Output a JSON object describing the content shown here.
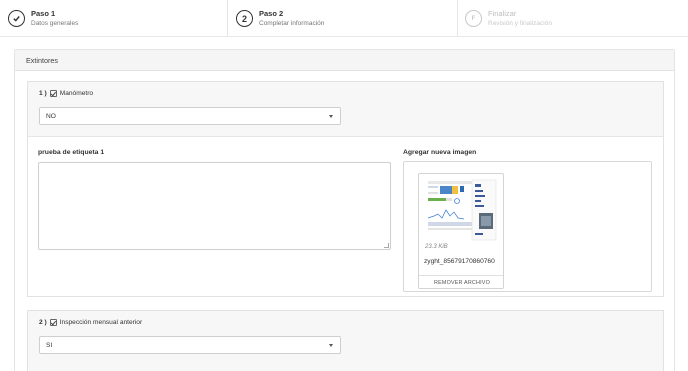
{
  "stepper": {
    "steps": [
      {
        "badge": "",
        "title": "Paso 1",
        "subtitle": "Datos generales",
        "state": "done"
      },
      {
        "badge": "2",
        "title": "Paso 2",
        "subtitle": "Completar información",
        "state": "active"
      },
      {
        "badge": "F",
        "title": "Finalizar",
        "subtitle": "Revisión y finalización",
        "state": "disabled"
      }
    ]
  },
  "section": {
    "title": "Extintores"
  },
  "questions": [
    {
      "number": "1 )",
      "label": "Manómetro",
      "selected": "NO",
      "text_field_label": "prueba de etiqueta 1",
      "image_field_label": "Agregar nueva imagen",
      "file": {
        "size": "23.3 KiB",
        "name": "zyght_85679170860760",
        "remove_label": "REMOVER ARCHIVO"
      }
    },
    {
      "number": "2 )",
      "label": "Inspección mensual anterior",
      "selected": "SI"
    }
  ],
  "colors": {
    "header_bg": "#f5f5f5",
    "border": "#e2e2e2",
    "text": "#333333",
    "muted": "#c8c8c8"
  }
}
